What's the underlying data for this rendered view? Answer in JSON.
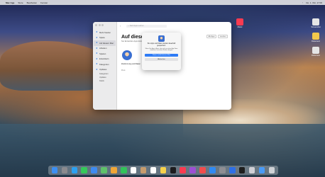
{
  "menubar": {
    "app_name": "Mac App",
    "menus": [
      "Store",
      "Bearbeiten",
      "Fenster"
    ],
    "clock": "Do. 1. Okt. 17:00"
  },
  "desktop_icons": [
    {
      "label": "Music",
      "color": "#fb3b51"
    },
    {
      "label": "Screenshot",
      "color": "#e6e6e6"
    },
    {
      "label": "Dokument",
      "color": "#f2c94c"
    },
    {
      "label": "Dokument",
      "color": "#e5e5e5"
    }
  ],
  "window": {
    "search_placeholder": "Nach Apps suchen",
    "sidebar": [
      {
        "icon": "star-icon",
        "label": "Mehr Kaufen",
        "active": false
      },
      {
        "icon": "star-icon",
        "label": "Spiele",
        "active": false
      },
      {
        "icon": "star-icon",
        "label": "Auf diesem Mac",
        "active": true
      },
      {
        "icon": "star-icon",
        "label": "Arbeiten",
        "active": false
      },
      {
        "icon": "star-icon",
        "label": "Spielen",
        "active": false
      },
      {
        "icon": "star-icon",
        "label": "Entwickeln",
        "active": false
      },
      {
        "icon": "star-icon",
        "label": "Kategorien",
        "active": false
      },
      {
        "icon": "star-icon",
        "label": "Updates",
        "active": false
      }
    ],
    "sidebar_sub": [
      "Kategorien",
      "Updates",
      "Käufe"
    ],
    "title": "Auf diesem",
    "subtitle": "Nur Entwickler-Apps Erste Apps",
    "toolbar_buttons": [
      "Alle Apps",
      "Installiert"
    ],
    "app_name": "Zustimmung und Daten",
    "app_extra": "Preis"
  },
  "dialog": {
    "message": "Ihre Apps und Daten werden dauerhaft gespeichert.",
    "note": "Wenn Sie Apps öffnen, die nicht aus dem App Store stammen, kann dies Risiken bergen.",
    "primary": "Weiter zu Auf diesem Mac",
    "secondary": "Abbrechen"
  },
  "dock": {
    "icons": [
      {
        "name": "finder-icon",
        "color": "#3c8ff2"
      },
      {
        "name": "launchpad-icon",
        "color": "#8a8a8e"
      },
      {
        "name": "safari-icon",
        "color": "#2da0f0"
      },
      {
        "name": "messages-icon",
        "color": "#35c85a"
      },
      {
        "name": "mail-icon",
        "color": "#3e8bf0"
      },
      {
        "name": "maps-icon",
        "color": "#5fc16a"
      },
      {
        "name": "photos-icon",
        "color": "#f0a637"
      },
      {
        "name": "facetime-icon",
        "color": "#33c35a"
      },
      {
        "name": "calendar-icon",
        "color": "#ffffff"
      },
      {
        "name": "contacts-icon",
        "color": "#c69c6d"
      },
      {
        "name": "reminders-icon",
        "color": "#ffffff"
      },
      {
        "name": "notes-icon",
        "color": "#f6d24b"
      },
      {
        "name": "tv-icon",
        "color": "#1c1c1e"
      },
      {
        "name": "music-icon",
        "color": "#fb3b51"
      },
      {
        "name": "podcasts-icon",
        "color": "#9d4fd4"
      },
      {
        "name": "news-icon",
        "color": "#f24d4d"
      },
      {
        "name": "appstore-icon",
        "color": "#2f8af3"
      },
      {
        "name": "settings-icon",
        "color": "#8e8e93"
      },
      {
        "name": "xcode-icon",
        "color": "#2e6fe6"
      },
      {
        "name": "terminal-icon",
        "color": "#1e1e1e"
      },
      {
        "name": "preview-icon",
        "color": "#d0d0d6"
      },
      {
        "name": "downloads-icon",
        "color": "#4a9bf6"
      },
      {
        "name": "trash-icon",
        "color": "#cfd2d6"
      }
    ]
  }
}
